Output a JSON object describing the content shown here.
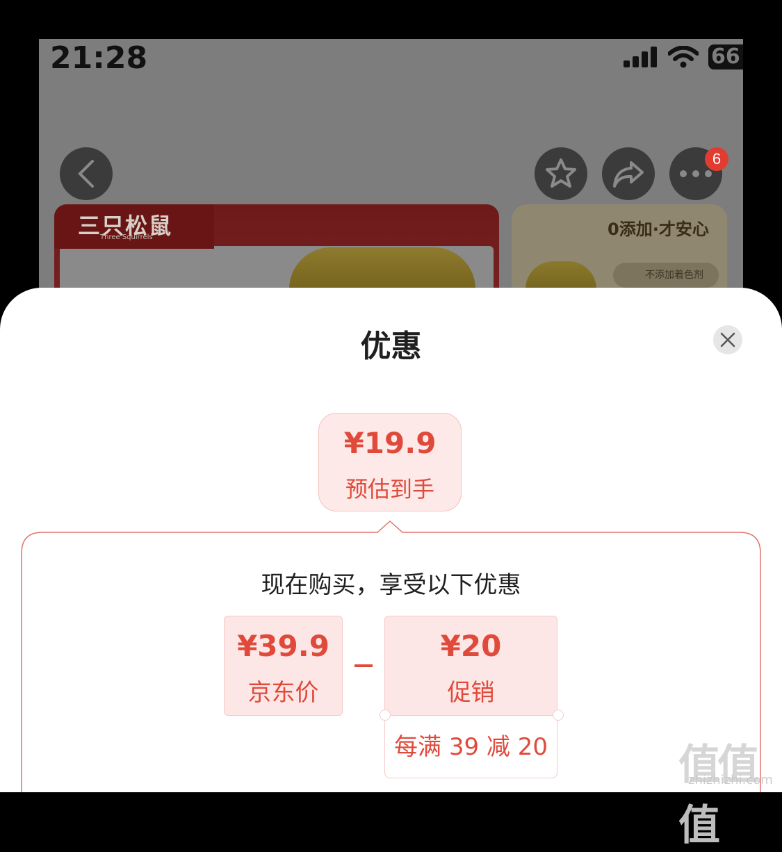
{
  "status_bar": {
    "time": "21:28",
    "battery": "66"
  },
  "top_actions": {
    "more_badge": "6"
  },
  "banner": {
    "brand_cn": "三只松鼠",
    "brand_en": "Three Squirrels",
    "slogan": "0添加·才安心",
    "feature": "不添加着色剂"
  },
  "sheet": {
    "title": "优惠",
    "estimate": {
      "price": "¥19.9",
      "label": "预估到手"
    },
    "detail_title": "现在购买，享受以下优惠",
    "jd_price": {
      "amount": "¥39.9",
      "label": "京东价"
    },
    "promotion": {
      "amount": "¥20",
      "label": "促销",
      "rule": "每满 39 减 20"
    }
  },
  "watermark": {
    "main": "值值值",
    "sub": "zhizhizhi.com"
  },
  "colors": {
    "accent": "#e04a3b",
    "accent_bg": "#fde7e6",
    "overlay": "#7d7d7d"
  }
}
